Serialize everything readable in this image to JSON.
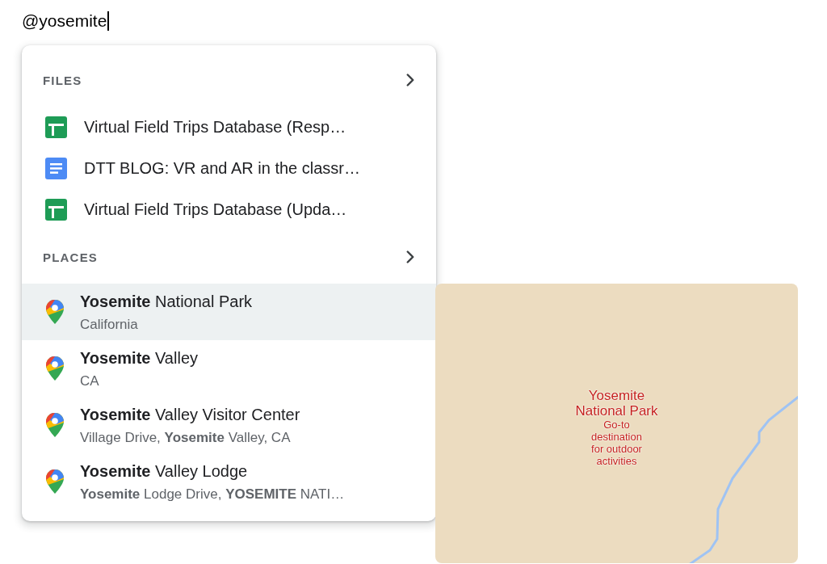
{
  "editor": {
    "typed_text": "@yosemite"
  },
  "mention_menu": {
    "files": {
      "title": "FILES",
      "items": [
        {
          "kind": "spreadsheet",
          "name": "Virtual Field Trips Database (Resp…"
        },
        {
          "kind": "document",
          "name": "DTT BLOG: VR and AR in the classr…"
        },
        {
          "kind": "spreadsheet",
          "name": "Virtual Field Trips Database (Upda…"
        }
      ]
    },
    "places": {
      "title": "PLACES",
      "items": [
        {
          "title": "**Yosemite** National Park",
          "subtitle": "California",
          "selected": true
        },
        {
          "title": "**Yosemite** Valley",
          "subtitle": "CA",
          "selected": false
        },
        {
          "title": "**Yosemite** Valley Visitor Center",
          "subtitle": "Village Drive, **Yosemite** Valley, CA",
          "selected": false
        },
        {
          "title": "**Yosemite** Valley Lodge",
          "subtitle": "**Yosemite** Lodge Drive, **YOSEMITE** NATI…",
          "selected": false
        }
      ]
    }
  },
  "map_preview": {
    "place_name": "Yosemite National Park",
    "description": "Go-to destination for outdoor activities"
  }
}
